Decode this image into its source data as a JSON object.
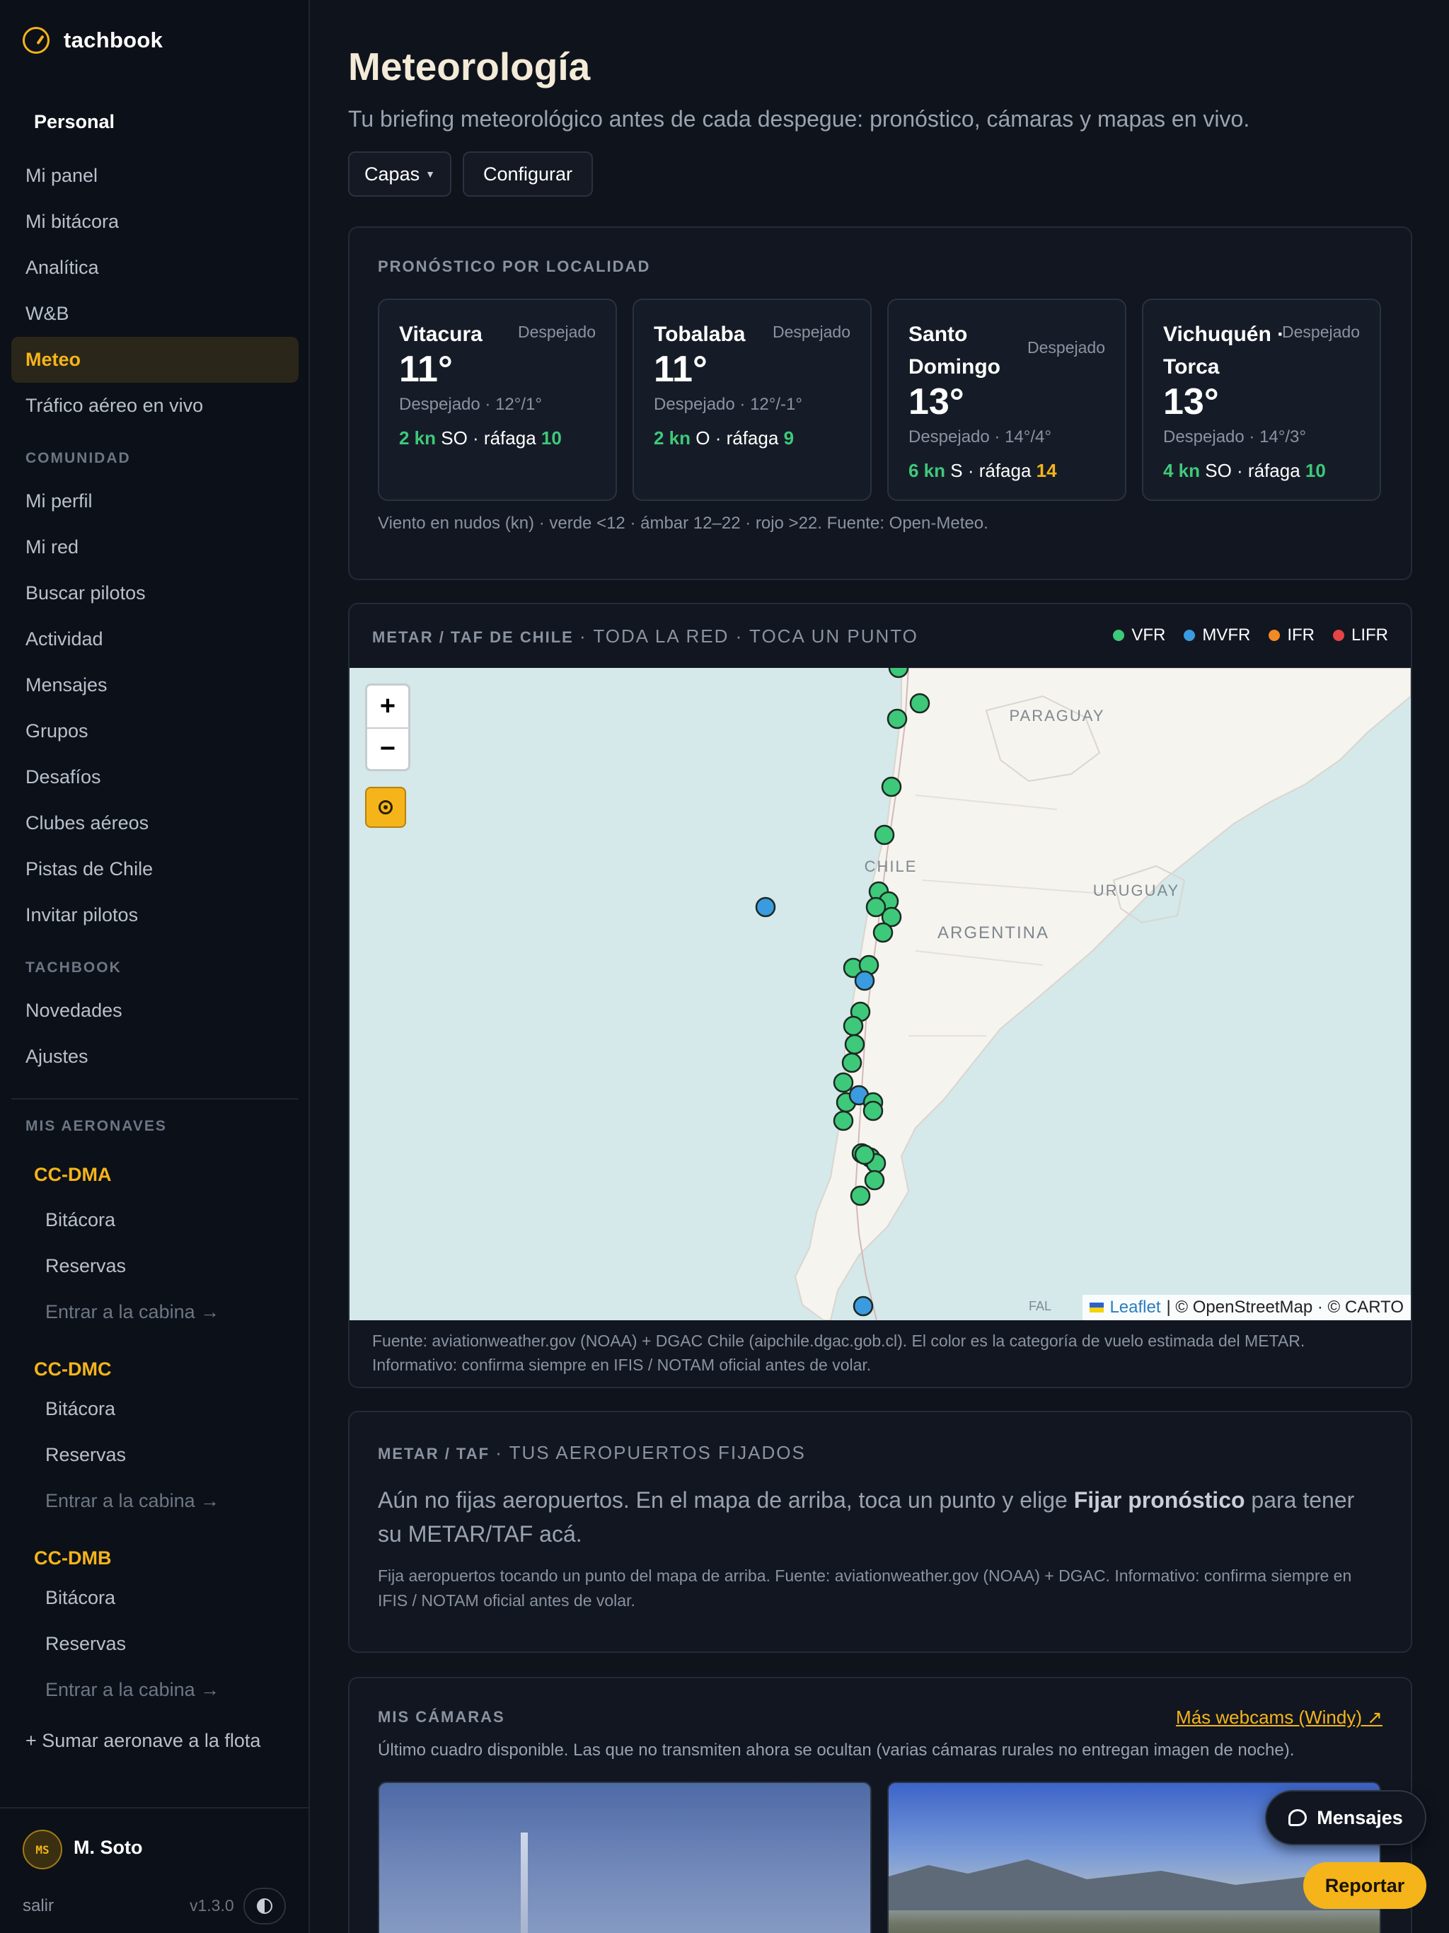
{
  "brand": {
    "name": "tachbook"
  },
  "sidebar": {
    "personal_title": "Personal",
    "personal": [
      "Mi panel",
      "Mi bitácora",
      "Analítica",
      "W&B",
      "Meteo",
      "Tráfico aéreo en vivo"
    ],
    "active_item": "Meteo",
    "community_title": "COMUNIDAD",
    "community": [
      "Mi perfil",
      "Mi red",
      "Buscar pilotos",
      "Actividad",
      "Mensajes",
      "Grupos",
      "Desafíos",
      "Clubes aéreos",
      "Pistas de Chile",
      "Invitar pilotos"
    ],
    "tachbook_title": "TACHBOOK",
    "tachbook": [
      "Novedades",
      "Ajustes"
    ],
    "aircraft_title": "MIS AERONAVES",
    "aircraft": [
      {
        "reg": "CC-DMA",
        "items": [
          "Bitácora",
          "Reservas",
          "Entrar a la cabina →"
        ]
      },
      {
        "reg": "CC-DMC",
        "items": [
          "Bitácora",
          "Reservas",
          "Entrar a la cabina →"
        ]
      },
      {
        "reg": "CC-DMB",
        "items": [
          "Bitácora",
          "Reservas",
          "Entrar a la cabina →"
        ]
      }
    ],
    "add_aircraft": "+ Sumar aeronave a la flota"
  },
  "user": {
    "initials": "MS",
    "name": "M. Soto",
    "logout": "salir",
    "version": "v1.3.0"
  },
  "header": {
    "title": "Meteorología",
    "subtitle": "Tu briefing meteorológico antes de cada despegue: pronóstico, cámaras y mapas en vivo.",
    "layers_button": "Capas",
    "config_button": "Configurar"
  },
  "forecast": {
    "label": "PRONÓSTICO POR LOCALIDAD",
    "locations": [
      {
        "name": "Vitacura",
        "condition": "Despejado",
        "temp": "11°",
        "range": "Despejado · 12°/1°",
        "wind": "2 kn",
        "dir": "SO · ráfaga",
        "gust": "10",
        "gust_level": "green"
      },
      {
        "name": "Tobalaba",
        "condition": "Despejado",
        "temp": "11°",
        "range": "Despejado · 12°/-1°",
        "wind": "2 kn",
        "dir": "O · ráfaga",
        "gust": "9",
        "gust_level": "green"
      },
      {
        "name": "Santo Domingo",
        "condition": "Despejado",
        "temp": "13°",
        "range": "Despejado · 14°/4°",
        "wind": "6 kn",
        "dir": "S · ráfaga",
        "gust": "14",
        "gust_level": "amber"
      },
      {
        "name": "Vichuquén · Torca",
        "condition": "Despejado",
        "temp": "13°",
        "range": "Despejado · 14°/3°",
        "wind": "4 kn",
        "dir": "SO · ráfaga",
        "gust": "10",
        "gust_level": "green"
      }
    ],
    "note": "Viento en nudos (kn) · verde <12 · ámbar 12–22 · rojo >22. Fuente: Open-Meteo."
  },
  "metar_map": {
    "label": "METAR / TAF DE CHILE",
    "label_suffix": "· TODA LA RED · TOCA UN PUNTO",
    "legend": [
      {
        "name": "VFR",
        "color": "#3ec97a"
      },
      {
        "name": "MVFR",
        "color": "#3b9be0"
      },
      {
        "name": "IFR",
        "color": "#f08a24"
      },
      {
        "name": "LIFR",
        "color": "#e64545"
      }
    ],
    "map_labels": {
      "paraguay": "PARAGUAY",
      "chile": "CHILE",
      "uruguay": "URUGUAY",
      "argentina": "ARGENTINA",
      "falkland": "FAL"
    },
    "zoom_in": "+",
    "zoom_out": "−",
    "attribution_leaflet": "Leaflet",
    "attribution_rest": "| © OpenStreetMap · © CARTO",
    "vfr_count": 30,
    "mvfr_count": 4,
    "note": "Fuente: aviationweather.gov (NOAA) + DGAC Chile (aipchile.dgac.gob.cl). El color es la categoría de vuelo estimada del METAR. Informativo: confirma siempre en IFIS / NOTAM oficial antes de volar."
  },
  "fixed_airports": {
    "label": "METAR / TAF",
    "label_suffix": "· TUS AEROPUERTOS FIJADOS",
    "main_before": "Aún no fijas aeropuertos. En el mapa de arriba, toca un punto y elige ",
    "main_bold": "Fijar pronóstico",
    "main_after": " para tener su METAR/TAF acá.",
    "note": "Fija aeropuertos tocando un punto del mapa de arriba. Fuente: aviationweather.gov (NOAA) + DGAC. Informativo: confirma siempre en IFIS / NOTAM oficial antes de volar."
  },
  "cameras": {
    "label": "MIS CÁMARAS",
    "link": "Más webcams (Windy) ↗",
    "note": "Último cuadro disponible. Las que no transmiten ahora se ocultan (varias cámaras rurales no entregan imagen de noche)."
  },
  "fab": {
    "messages": "Mensajes",
    "report": "Reportar"
  }
}
